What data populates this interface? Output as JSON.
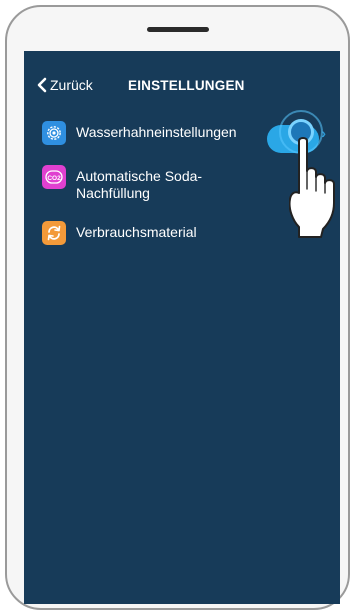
{
  "nav": {
    "back_label": "Zurück",
    "title": "EINSTELLUNGEN"
  },
  "settings": {
    "items": [
      {
        "label": "Wasserhahneinstellungen",
        "icon": "gear-icon",
        "icon_color": "#2f8fe0",
        "has_chevron": true,
        "chevron": "›"
      },
      {
        "label_line1": "Automatische Soda-",
        "label_line2": "Nachfüllung",
        "icon": "co2-icon",
        "icon_color": "#e040d0",
        "toggle_on": true
      },
      {
        "label": "Verbrauchsmaterial",
        "icon": "refresh-icon",
        "icon_color": "#f39a3a"
      }
    ]
  },
  "colors": {
    "screen_bg": "#173b59",
    "accent": "#2aa7e6",
    "text": "#ffffff"
  }
}
